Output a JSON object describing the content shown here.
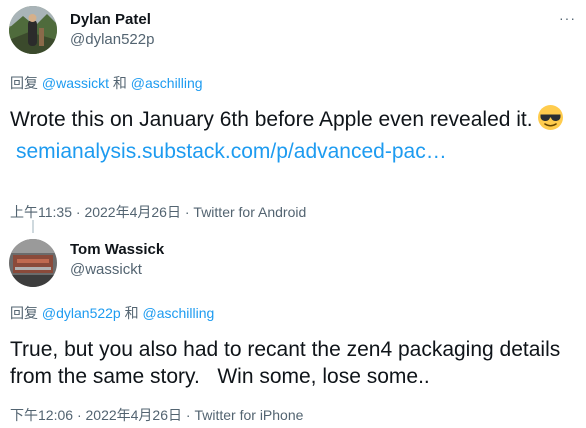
{
  "tweets": [
    {
      "author_name": "Dylan Patel",
      "author_handle": "@dylan522p",
      "more_label": "···",
      "replying_prefix": "回复",
      "replying_user1": "@wassickt",
      "replying_conj": "和",
      "replying_user2": "@aschilling",
      "text": "Wrote this on January 6th before Apple even revealed it.",
      "emoji": "sunglasses",
      "link": "semianalysis.substack.com/p/advanced-pac…",
      "time": "上午11:35",
      "date": "2022年4月26日",
      "source": "Twitter for Android",
      "separator": "·"
    },
    {
      "author_name": "Tom Wassick",
      "author_handle": "@wassickt",
      "replying_prefix": "回复",
      "replying_user1": "@dylan522p",
      "replying_conj": "和",
      "replying_user2": "@aschilling",
      "text": "True, but you also had to recant the zen4 packaging details from the same story.   Win some, lose some..",
      "time": "下午12:06",
      "date": "2022年4月26日",
      "source": "Twitter for iPhone",
      "separator": "·"
    }
  ],
  "colors": {
    "accent": "#1d9bf0",
    "text": "#0f1419",
    "secondary": "#536471",
    "thread_line": "#cfd9de"
  }
}
